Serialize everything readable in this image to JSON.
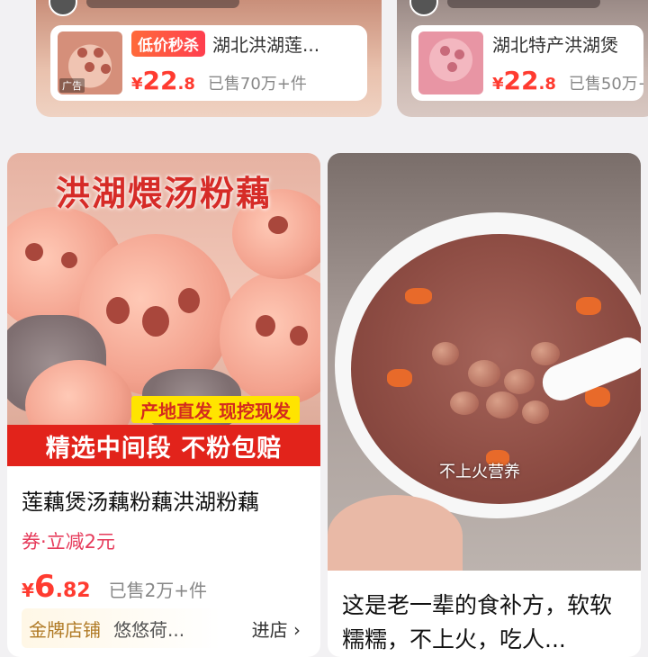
{
  "ads": [
    {
      "badge": "低价秒杀",
      "title": "湖北洪湖莲...",
      "price_symbol": "¥",
      "price_int": "22",
      "price_dec": ".8",
      "sold": "已售70万+件",
      "thumb_tag": "广告"
    },
    {
      "title": "湖北特产洪湖煲",
      "price_symbol": "¥",
      "price_int": "22",
      "price_dec": ".8",
      "sold": "已售50万+"
    }
  ],
  "product_left": {
    "hero_title": "洪湖煨汤粉藕",
    "badge_yellow": "产地直发 现挖现发",
    "badge_red": "精选中间段 不粉包赔",
    "title": "莲藕煲汤藕粉藕洪湖粉藕",
    "coupon": "券·立减2元",
    "price_symbol": "¥",
    "price_int": "6",
    "price_dec": ".82",
    "sold": "已售2万+件",
    "shop_tier": "金牌店铺",
    "shop_name": "悠悠荷...",
    "shop_enter": "进店 ›"
  },
  "product_right": {
    "caption": "不上火营养",
    "title": "这是老一辈的食补方，软软糯糯，不上火，吃人..."
  }
}
